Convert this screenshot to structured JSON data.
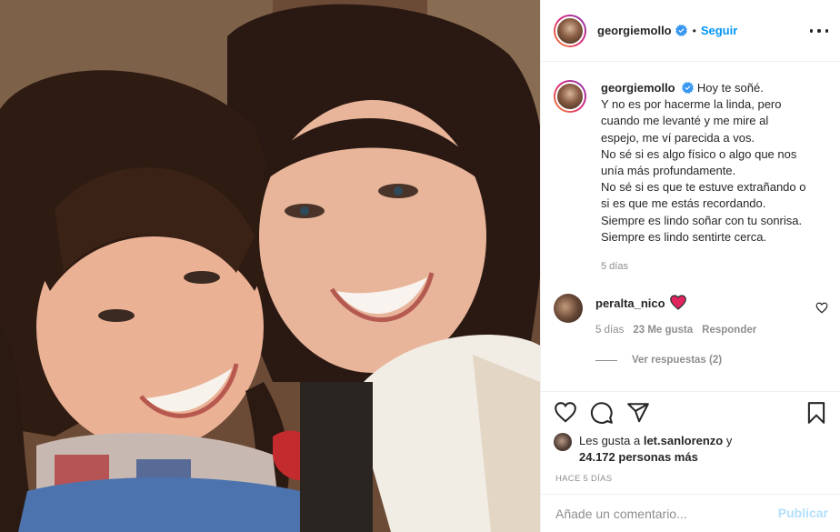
{
  "post": {
    "author": "georgiemollo",
    "follow_label": "Seguir",
    "dot": "•"
  },
  "caption": {
    "author": "georgiemollo",
    "lines": [
      "Hoy te soñé.",
      "Y no es por hacerme la linda, pero",
      "cuando me levanté y me mire al",
      "espejo, me ví parecida a vos.",
      "No sé si es algo físico o algo que nos",
      "unía más profundamente.",
      "No sé si es que te estuve extrañando o",
      "si es que me estás recordando.",
      "Siempre es lindo soñar con tu sonrisa.",
      "Siempre es lindo sentirte cerca."
    ],
    "time": "5 días"
  },
  "comment": {
    "user": "peralta_nico",
    "emoji": "heart",
    "time": "5 días",
    "likes": "23 Me gusta",
    "reply_label": "Responder"
  },
  "replies_label": "Ver respuestas (2)",
  "likes_section": {
    "prefix": "Les gusta a ",
    "user": "let.sanlorenzo",
    "middle": " y",
    "count": "24.172 personas más"
  },
  "post_time": "HACE 5 DÍAS",
  "comment_box": {
    "placeholder": "Añade un comentario...",
    "publish_label": "Publicar"
  },
  "colors": {
    "accent": "#0095f6",
    "publish_disabled": "#b2dffc",
    "secondary_text": "#8e8e8e",
    "heart_emoji": "#e0245e"
  },
  "icons": [
    "verified-icon",
    "more-options-icon",
    "heart-icon",
    "comment-icon",
    "share-icon",
    "bookmark-icon",
    "heart-emoji-icon"
  ]
}
